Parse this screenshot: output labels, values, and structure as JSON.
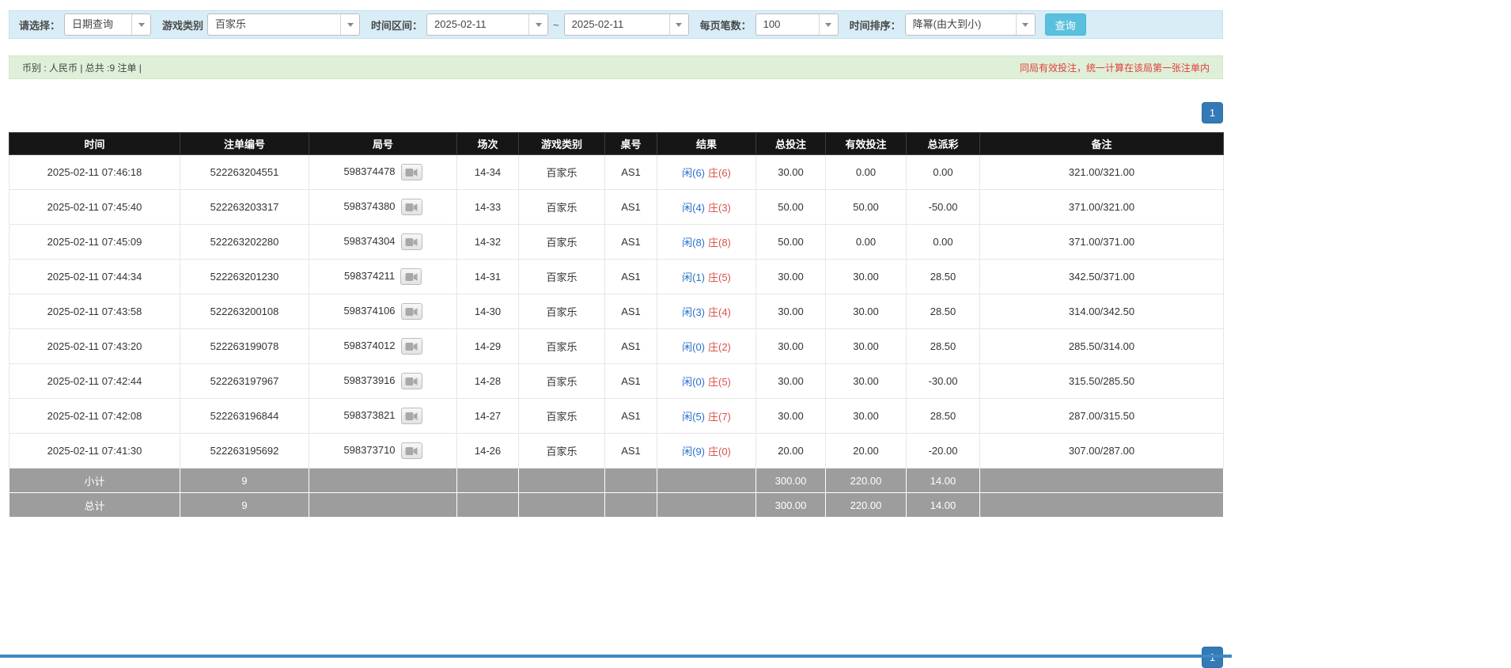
{
  "filter_bar": {
    "select_label": "请选择：",
    "select_value": "日期查询",
    "game_type_label": "游戏类别",
    "game_type_value": "百家乐",
    "time_range_label": "时间区间：",
    "date_from": "2025-02-11",
    "range_separator": "~",
    "date_to": "2025-02-11",
    "page_size_label": "每页笔数：",
    "page_size_value": "100",
    "sort_label": "时间排序：",
    "sort_value": "降幂(由大到小)",
    "query_button_label": "查询"
  },
  "summary_bar": {
    "left_text": "币别 : 人民币 | 总共 :9 注单 |",
    "right_notice": "同局有效投注，统一计算在该局第一张注单内"
  },
  "pagination": {
    "current_page": "1"
  },
  "table": {
    "headers": [
      "时间",
      "注单编号",
      "局号",
      "场次",
      "游戏类别",
      "桌号",
      "结果",
      "总投注",
      "有效投注",
      "总派彩",
      "备注"
    ],
    "rows": [
      {
        "time": "2025-02-11 07:46:18",
        "bet_id": "522263204551",
        "round_id": "598374478",
        "session": "14-34",
        "game": "百家乐",
        "table_no": "AS1",
        "result_player": "闲(6)",
        "result_banker": "庄(6)",
        "total_bet": "30.00",
        "valid_bet": "0.00",
        "payout": "0.00",
        "remark": "321.00/321.00"
      },
      {
        "time": "2025-02-11 07:45:40",
        "bet_id": "522263203317",
        "round_id": "598374380",
        "session": "14-33",
        "game": "百家乐",
        "table_no": "AS1",
        "result_player": "闲(4)",
        "result_banker": "庄(3)",
        "total_bet": "50.00",
        "valid_bet": "50.00",
        "payout": "-50.00",
        "remark": "371.00/321.00"
      },
      {
        "time": "2025-02-11 07:45:09",
        "bet_id": "522263202280",
        "round_id": "598374304",
        "session": "14-32",
        "game": "百家乐",
        "table_no": "AS1",
        "result_player": "闲(8)",
        "result_banker": "庄(8)",
        "total_bet": "50.00",
        "valid_bet": "0.00",
        "payout": "0.00",
        "remark": "371.00/371.00"
      },
      {
        "time": "2025-02-11 07:44:34",
        "bet_id": "522263201230",
        "round_id": "598374211",
        "session": "14-31",
        "game": "百家乐",
        "table_no": "AS1",
        "result_player": "闲(1)",
        "result_banker": "庄(5)",
        "total_bet": "30.00",
        "valid_bet": "30.00",
        "payout": "28.50",
        "remark": "342.50/371.00"
      },
      {
        "time": "2025-02-11 07:43:58",
        "bet_id": "522263200108",
        "round_id": "598374106",
        "session": "14-30",
        "game": "百家乐",
        "table_no": "AS1",
        "result_player": "闲(3)",
        "result_banker": "庄(4)",
        "total_bet": "30.00",
        "valid_bet": "30.00",
        "payout": "28.50",
        "remark": "314.00/342.50"
      },
      {
        "time": "2025-02-11 07:43:20",
        "bet_id": "522263199078",
        "round_id": "598374012",
        "session": "14-29",
        "game": "百家乐",
        "table_no": "AS1",
        "result_player": "闲(0)",
        "result_banker": "庄(2)",
        "total_bet": "30.00",
        "valid_bet": "30.00",
        "payout": "28.50",
        "remark": "285.50/314.00"
      },
      {
        "time": "2025-02-11 07:42:44",
        "bet_id": "522263197967",
        "round_id": "598373916",
        "session": "14-28",
        "game": "百家乐",
        "table_no": "AS1",
        "result_player": "闲(0)",
        "result_banker": "庄(5)",
        "total_bet": "30.00",
        "valid_bet": "30.00",
        "payout": "-30.00",
        "remark": "315.50/285.50"
      },
      {
        "time": "2025-02-11 07:42:08",
        "bet_id": "522263196844",
        "round_id": "598373821",
        "session": "14-27",
        "game": "百家乐",
        "table_no": "AS1",
        "result_player": "闲(5)",
        "result_banker": "庄(7)",
        "total_bet": "30.00",
        "valid_bet": "30.00",
        "payout": "28.50",
        "remark": "287.00/315.50"
      },
      {
        "time": "2025-02-11 07:41:30",
        "bet_id": "522263195692",
        "round_id": "598373710",
        "session": "14-26",
        "game": "百家乐",
        "table_no": "AS1",
        "result_player": "闲(9)",
        "result_banker": "庄(0)",
        "total_bet": "20.00",
        "valid_bet": "20.00",
        "payout": "-20.00",
        "remark": "307.00/287.00"
      }
    ],
    "subtotal": {
      "label": "小计",
      "count": "9",
      "total_bet": "300.00",
      "valid_bet": "220.00",
      "payout": "14.00"
    },
    "total": {
      "label": "总计",
      "count": "9",
      "total_bet": "300.00",
      "valid_bet": "220.00",
      "payout": "14.00"
    }
  },
  "colors": {
    "filter_bar_bg": "#d9edf7",
    "summary_bar_bg": "#dff0d8",
    "table_header_bg": "#161616",
    "footer_row_bg": "#9d9d9d",
    "accent_blue": "#337ab7",
    "query_button_bg": "#5bc0de",
    "player_color": "#2a6fc9",
    "banker_color": "#d9534f",
    "negative_color": "#e03c3c",
    "notice_color": "#e03c3c"
  }
}
